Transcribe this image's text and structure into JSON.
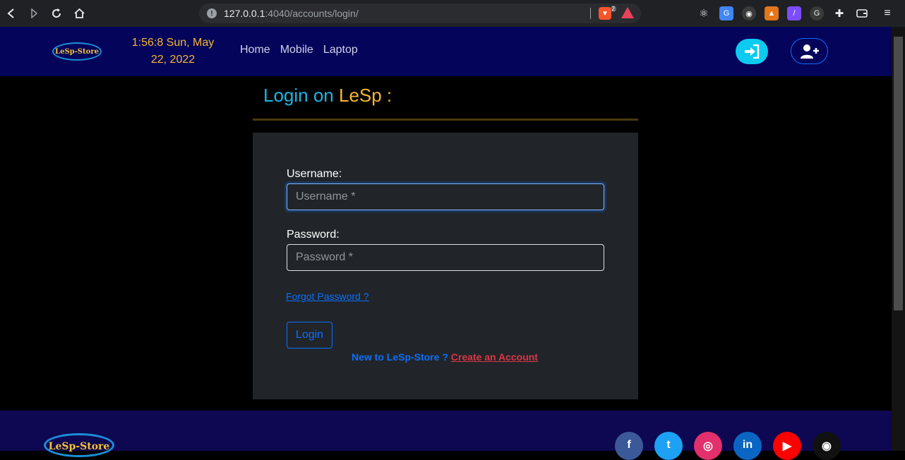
{
  "browser": {
    "url_host": "127.0.0.1",
    "url_rest": ":4040/accounts/login/",
    "brave_shield_count": "2"
  },
  "navbar": {
    "logo_text": "LeSp-Store",
    "clock_line1": "1:56:8 Sun, May",
    "clock_line2": "22, 2022",
    "links": [
      "Home",
      "Mobile",
      "Laptop"
    ]
  },
  "login": {
    "title_prefix": "Login on ",
    "title_brand": "LeSp :",
    "username_label": "Username:",
    "username_placeholder": "Username *",
    "password_label": "Password:",
    "password_placeholder": "Password *",
    "forgot_link": "Forgot Password ?",
    "submit_label": "Login",
    "signup_prompt": "New to LeSp-Store ? ",
    "signup_link": "Create an Account"
  },
  "footer": {
    "logo_text": "LeSp-Store",
    "social": [
      {
        "name": "facebook",
        "glyph": "f",
        "color": "#3b5998"
      },
      {
        "name": "twitter",
        "glyph": "t",
        "color": "#1da1f2"
      },
      {
        "name": "instagram",
        "glyph": "◎",
        "color": "#e1306c"
      },
      {
        "name": "linkedin",
        "glyph": "in",
        "color": "#0a66c2"
      },
      {
        "name": "youtube",
        "glyph": "▶",
        "color": "#ff0000"
      },
      {
        "name": "github",
        "glyph": "◉",
        "color": "#111111"
      }
    ]
  },
  "colors": {
    "navbar_bg": "#04045a",
    "accent_cyan": "#19b6e6",
    "accent_gold": "#f7b731",
    "primary": "#0d6efd",
    "danger": "#dc3545"
  }
}
